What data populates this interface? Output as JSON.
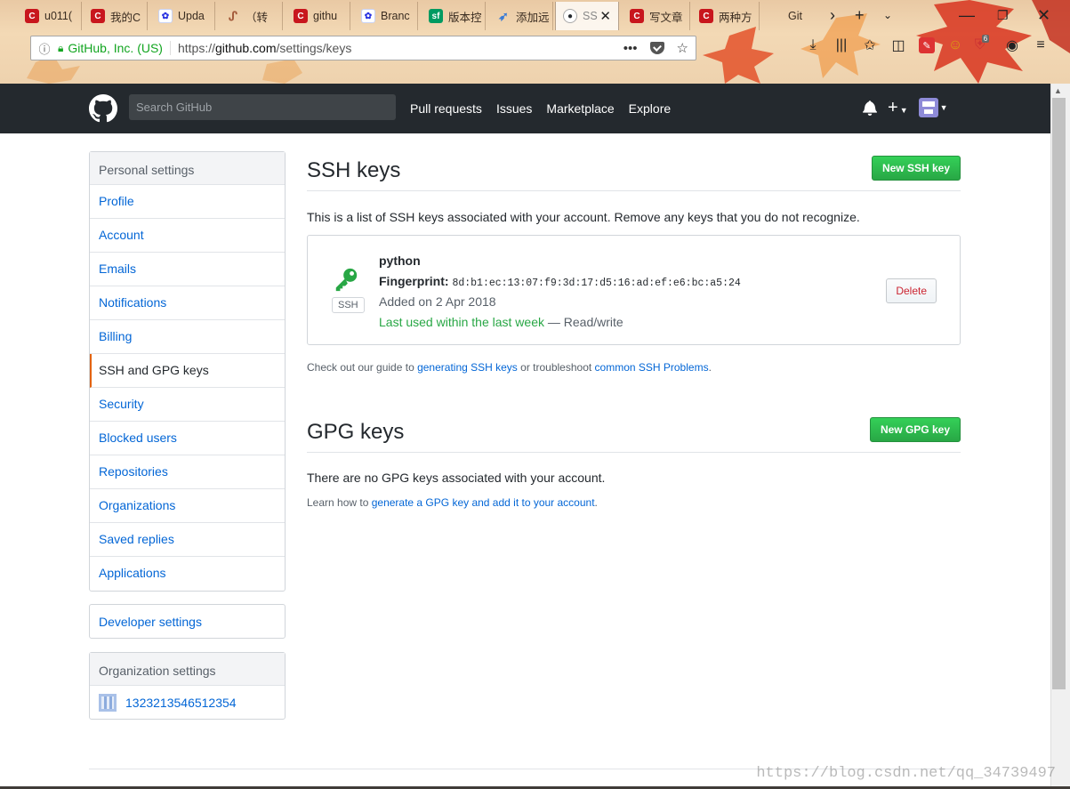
{
  "browser": {
    "tabs": [
      {
        "label": "u011(",
        "icon": "csdn"
      },
      {
        "label": "我的C",
        "icon": "csdn"
      },
      {
        "label": "Upda",
        "icon": "baidu"
      },
      {
        "label": "（转",
        "icon": "rd"
      },
      {
        "label": "githu",
        "icon": "csdn"
      },
      {
        "label": "Branc",
        "icon": "baidu"
      },
      {
        "label": "版本控",
        "icon": "sf"
      },
      {
        "label": "添加远",
        "icon": "rocket"
      },
      {
        "label": "SS",
        "icon": "github",
        "active": true
      },
      {
        "label": "写文章",
        "icon": "csdn"
      },
      {
        "label": "两种方",
        "icon": "csdn"
      },
      {
        "label": "Git",
        "icon": "none"
      }
    ],
    "identity": "GitHub, Inc. (US)",
    "url_prefix": "https://",
    "url_host": "github.com",
    "url_path": "/settings/keys",
    "toolbar_badge": "6"
  },
  "header": {
    "search_placeholder": "Search GitHub",
    "nav": [
      "Pull requests",
      "Issues",
      "Marketplace",
      "Explore"
    ]
  },
  "sidebar": {
    "heading": "Personal settings",
    "items": [
      {
        "label": "Profile"
      },
      {
        "label": "Account"
      },
      {
        "label": "Emails"
      },
      {
        "label": "Notifications"
      },
      {
        "label": "Billing"
      },
      {
        "label": "SSH and GPG keys",
        "selected": true
      },
      {
        "label": "Security"
      },
      {
        "label": "Blocked users"
      },
      {
        "label": "Repositories"
      },
      {
        "label": "Organizations"
      },
      {
        "label": "Saved replies"
      },
      {
        "label": "Applications"
      }
    ],
    "developer_settings": "Developer settings",
    "org_heading": "Organization settings",
    "org_name": "1323213546512354"
  },
  "ssh": {
    "title": "SSH keys",
    "new_button": "New SSH key",
    "intro": "This is a list of SSH keys associated with your account. Remove any keys that you do not recognize.",
    "key": {
      "badge": "SSH",
      "name": "python",
      "fingerprint_label": "Fingerprint:",
      "fingerprint": "8d:b1:ec:13:07:f9:3d:17:d5:16:ad:ef:e6:bc:a5:24",
      "added": "Added on 2 Apr 2018",
      "last_used": "Last used within the last week",
      "access": " — Read/write",
      "delete_label": "Delete"
    },
    "guide_prefix": "Check out our guide to ",
    "guide_link1": "generating SSH keys",
    "guide_middle": " or troubleshoot ",
    "guide_link2": "common SSH Problems",
    "guide_suffix": "."
  },
  "gpg": {
    "title": "GPG keys",
    "new_button": "New GPG key",
    "empty": "There are no GPG keys associated with your account.",
    "learn_prefix": "Learn how to ",
    "learn_link": "generate a GPG key and add it to your account",
    "learn_suffix": "."
  },
  "watermark": "https://blog.csdn.net/qq_34739497",
  "colors": {
    "header_bg": "#24292e",
    "link": "#0366d6",
    "green_button": "#28a745",
    "selected_border": "#e36209",
    "delete_text": "#cb2431",
    "key_icon": "#28a745"
  }
}
